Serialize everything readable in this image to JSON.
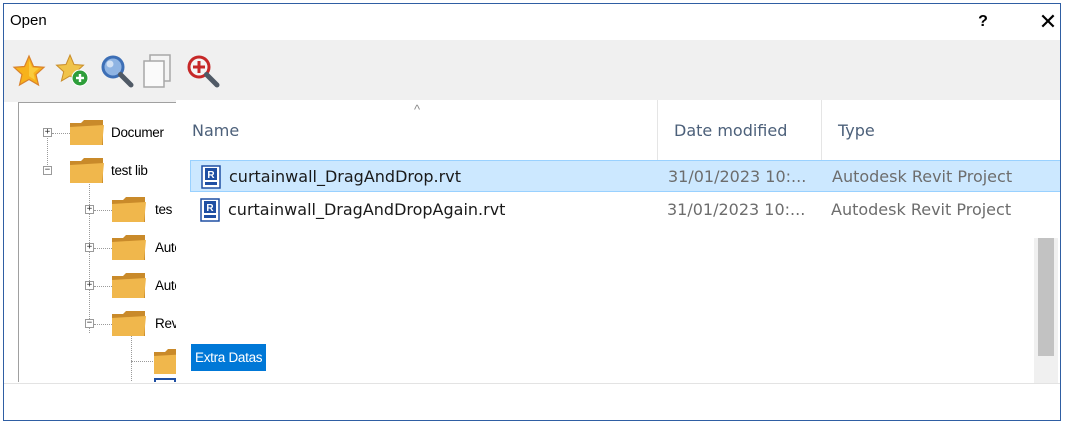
{
  "window": {
    "title": "Open",
    "help_glyph": "?",
    "close_glyph": "✕"
  },
  "toolbar": {
    "buttons": [
      {
        "icon": "favorites-star-icon"
      },
      {
        "icon": "add-to-favorites-icon"
      },
      {
        "icon": "search-icon"
      },
      {
        "icon": "copy-pages-icon"
      },
      {
        "icon": "zoom-in-icon"
      }
    ]
  },
  "tree": {
    "items": [
      {
        "label": "Documer",
        "expander": "+"
      },
      {
        "label": "test lib",
        "expander": "−"
      },
      {
        "label": "tes",
        "expander": "+"
      },
      {
        "label": "AutoCAD",
        "expander": "+"
      },
      {
        "label": "AutoCAD Revit",
        "expander": "+"
      },
      {
        "label": "Revit",
        "expander": "−"
      },
      {
        "label": "Extra Datas",
        "expander": ""
      }
    ]
  },
  "list": {
    "sort_glyph": "^",
    "columns": {
      "name": "Name",
      "date": "Date modified",
      "type": "Type"
    },
    "files": [
      {
        "name": "curtainwall_DragAndDrop.rvt",
        "date": "31/01/2023 10:...",
        "type": "Autodesk Revit Project",
        "icon_letter": "R"
      },
      {
        "name": "curtainwall_DragAndDropAgain.rvt",
        "date": "31/01/2023 10:...",
        "type": "Autodesk Revit Project",
        "icon_letter": "R"
      }
    ]
  },
  "colors": {
    "accent": "#0078d7",
    "row_selected": "#cce8ff",
    "folder": "#e8a83a"
  }
}
